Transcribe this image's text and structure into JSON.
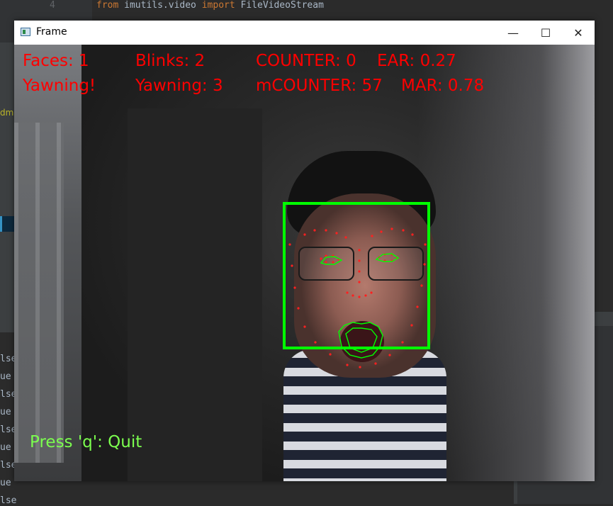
{
  "ide": {
    "line_number": "4",
    "code_line": "from imutils.video import FileVideoStream",
    "code_kw_from": "from",
    "code_module": " imutils.video ",
    "code_kw_import": "import",
    "code_name": " FileVideoStream",
    "left_snippet": "dm",
    "console_lines": [
      "lse",
      "ue",
      "lse",
      "ue",
      "lse",
      "ue",
      "lse",
      "ue",
      "lse"
    ]
  },
  "window": {
    "title": "Frame",
    "minimize_glyph": "—",
    "maximize_glyph": "☐",
    "close_glyph": "✕"
  },
  "hud": {
    "faces": "Faces: 1",
    "blinks": "Blinks: 2",
    "counter": "COUNTER: 0",
    "ear": "EAR: 0.27",
    "yawning_flag": "Yawning!",
    "yawning_count": "Yawning: 3",
    "mcounter": "mCOUNTER: 57",
    "mar": "MAR: 0.78",
    "quit_hint": "Press 'q': Quit"
  },
  "colors": {
    "hud_text": "#ff0000",
    "quit_text": "#7cff4f",
    "face_box": "#00ff00",
    "landmarks": "#ff2020",
    "contours": "#00ff00"
  }
}
